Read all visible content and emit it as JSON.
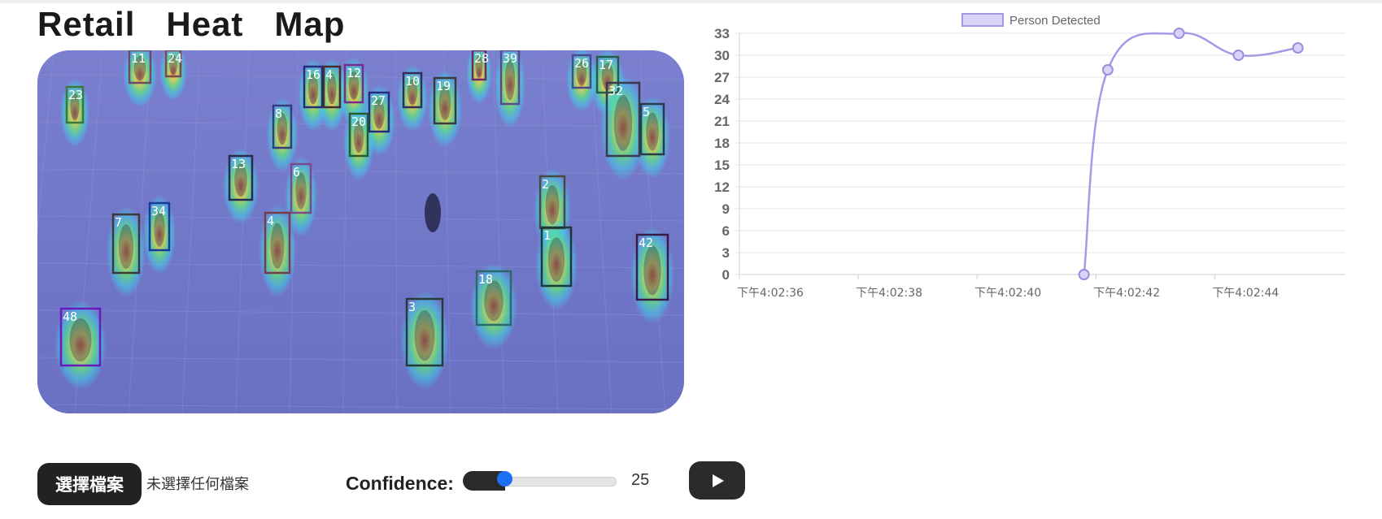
{
  "page": {
    "title": "Retail   Heat   Map"
  },
  "video": {
    "track_ids": [
      "11",
      "24",
      "28",
      "39",
      "26",
      "17",
      "23",
      "16",
      "4",
      "12",
      "10",
      "19",
      "27",
      "32",
      "8",
      "20",
      "13",
      "6",
      "7",
      "34",
      "4",
      "2",
      "18",
      "1",
      "3",
      "42",
      "48",
      "5"
    ]
  },
  "chart_data": {
    "type": "line",
    "legend": "Person Detected",
    "legend_position": "top-center",
    "x": [
      "下午4:02:41.8",
      "下午4:02:42.2",
      "下午4:02:43.4",
      "下午4:02:44.4",
      "下午4:02:45.4"
    ],
    "series": [
      {
        "name": "Person Detected",
        "values": [
          0,
          28,
          33,
          30,
          31
        ],
        "color": "#a59ae6"
      }
    ],
    "xticks": [
      "下午4:02:36",
      "下午4:02:38",
      "下午4:02:40",
      "下午4:02:42",
      "下午4:02:44"
    ],
    "yticks": [
      0,
      3,
      6,
      9,
      12,
      15,
      18,
      21,
      24,
      27,
      30,
      33
    ],
    "ylim": [
      0,
      33
    ],
    "grid": true
  },
  "controls": {
    "file_button_label": "選擇檔案",
    "file_status": "未選擇任何檔案",
    "confidence_label": "Confidence:",
    "confidence_value": "25",
    "confidence_fraction": 0.25
  },
  "colors": {
    "button_bg": "#222222",
    "slider_thumb": "#1a6ff2",
    "series_line": "#a59ae6"
  },
  "icons": {
    "play": "play-icon"
  }
}
